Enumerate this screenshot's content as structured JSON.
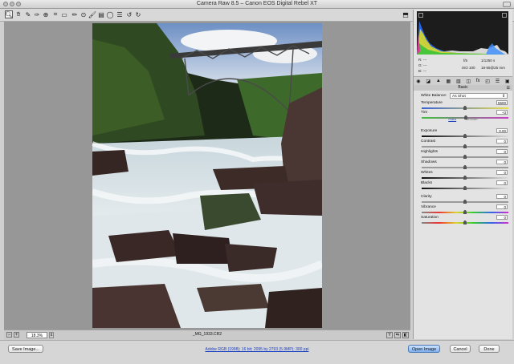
{
  "window": {
    "title": "Camera Raw 8.5  –  Canon EOS Digital Rebel XT"
  },
  "toolbar": {
    "tools": [
      "zoom-tool-icon",
      "hand-tool-icon",
      "white-balance-tool-icon",
      "color-sampler-tool-icon",
      "targeted-adjustment-tool-icon",
      "crop-tool-icon",
      "straighten-tool-icon",
      "spot-removal-tool-icon",
      "red-eye-removal-tool-icon",
      "adjustment-brush-icon",
      "graduated-filter-icon",
      "radial-filter-icon",
      "preferences-icon",
      "rotate-left-icon",
      "rotate-right-icon"
    ],
    "preview_label": "☐"
  },
  "status": {
    "zoom": "18.3%",
    "filename": "_MG_1933.CR2"
  },
  "camera_info": {
    "r_label": "R:",
    "g_label": "G:",
    "b_label": "B:",
    "rgb_placeholder": "---",
    "aperture": "f/5",
    "shutter": "1/1250 s",
    "iso": "ISO 100",
    "lens": "18-55@25 mm"
  },
  "panel": {
    "section": "Basic",
    "white_balance_label": "White Balance:",
    "white_balance_value": "As Shot",
    "auto_label": "Auto",
    "default_label": "Default",
    "sliders": [
      {
        "label": "Temperature",
        "value": "5500",
        "level": 0.5
      },
      {
        "label": "Tint",
        "value": "+3",
        "level": 0.51
      },
      {
        "label": "Exposure",
        "value": "0.00",
        "level": 0.5
      },
      {
        "label": "Contrast",
        "value": "0",
        "level": 0.5
      },
      {
        "label": "Highlights",
        "value": "0",
        "level": 0.5
      },
      {
        "label": "Shadows",
        "value": "0",
        "level": 0.5
      },
      {
        "label": "Whites",
        "value": "0",
        "level": 0.5
      },
      {
        "label": "Blacks",
        "value": "0",
        "level": 0.5
      },
      {
        "label": "Clarity",
        "value": "0",
        "level": 0.5
      },
      {
        "label": "Vibrance",
        "value": "0",
        "level": 0.5
      },
      {
        "label": "Saturation",
        "value": "0",
        "level": 0.5
      }
    ]
  },
  "footer": {
    "save_label": "Save Image...",
    "workflow_label": "Adobe RGB (1998); 16 bit; 2095 by 2793 (5.9MP); 300 ppi",
    "open_label": "Open Image",
    "cancel_label": "Cancel",
    "done_label": "Done"
  },
  "colors": {
    "accent": "#4a78b5",
    "link": "#1a3fc0",
    "preview_bg": "#979797"
  }
}
